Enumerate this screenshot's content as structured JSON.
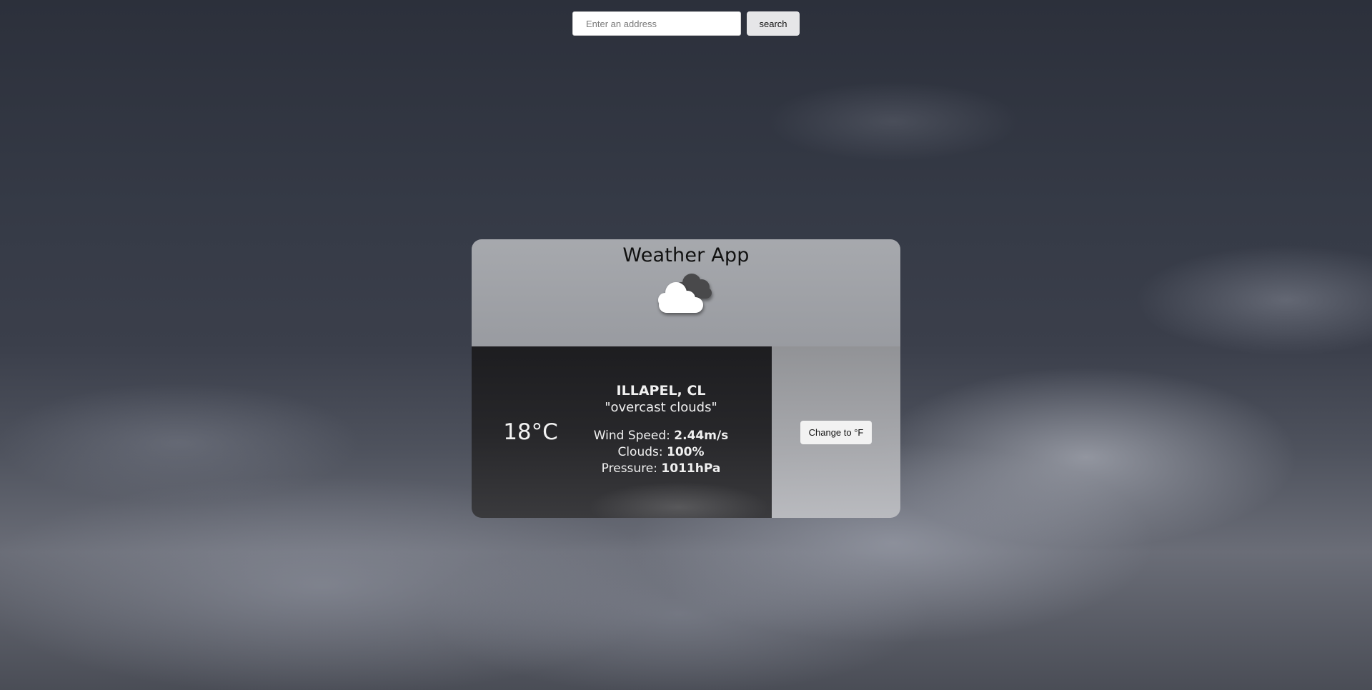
{
  "search": {
    "placeholder": "Enter an address",
    "value": "",
    "button_label": "search"
  },
  "card": {
    "title": "Weather App",
    "icon": "overcast-clouds-icon",
    "temperature": "18°C",
    "city": "ILLAPEL, CL",
    "description": "\"overcast clouds\"",
    "wind": {
      "label": "Wind Speed: ",
      "value": "2.44m/s"
    },
    "clouds": {
      "label": "Clouds: ",
      "value": "100%"
    },
    "pressure": {
      "label": "Pressure: ",
      "value": "1011hPa"
    },
    "unit_button_label": "Change to °F"
  }
}
